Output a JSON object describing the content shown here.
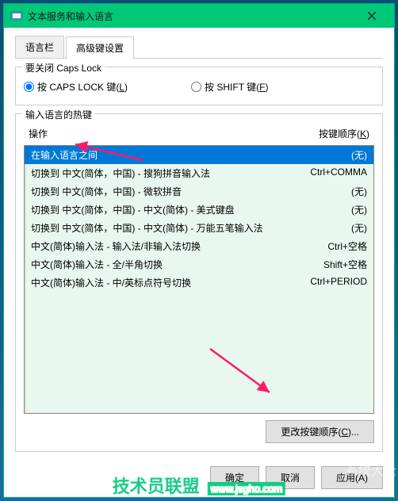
{
  "window": {
    "title": "文本服务和输入语言"
  },
  "tabs": {
    "tab1": "语言栏",
    "tab2": "高级键设置"
  },
  "capslock": {
    "legend": "要关闭 Caps Lock",
    "opt1_prefix": "按 CAPS LOCK 键(",
    "opt1_key": "L",
    "opt1_suffix": ")",
    "opt2_prefix": "按 SHIFT 键(",
    "opt2_key": "F",
    "opt2_suffix": ")"
  },
  "hotkeys": {
    "legend": "输入语言的热键",
    "col_action": "操作",
    "col_seq_prefix": "按键顺序(",
    "col_seq_key": "K",
    "col_seq_suffix": ")",
    "rows": [
      {
        "action": "在输入语言之间",
        "seq": "(无)"
      },
      {
        "action": "切换到 中文(简体，中国) - 搜狗拼音输入法",
        "seq": "Ctrl+COMMA"
      },
      {
        "action": "切换到 中文(简体，中国) - 微软拼音",
        "seq": "(无)"
      },
      {
        "action": "切换到 中文(简体，中国) - 中文(简体) - 美式键盘",
        "seq": "(无)"
      },
      {
        "action": "切换到 中文(简体，中国) - 中文(简体) - 万能五笔输入法",
        "seq": "(无)"
      },
      {
        "action": "中文(简体)输入法 - 输入法/非输入法切换",
        "seq": "Ctrl+空格"
      },
      {
        "action": "中文(简体)输入法 - 全/半角切换",
        "seq": "Shift+空格"
      },
      {
        "action": "中文(简体)输入法 - 中/英标点符号切换",
        "seq": "Ctrl+PERIOD"
      }
    ],
    "change_btn_prefix": "更改按键顺序(",
    "change_btn_key": "C",
    "change_btn_suffix": ")..."
  },
  "buttons": {
    "ok": "确定",
    "cancel": "取消",
    "apply": "应用(A)"
  },
  "watermark": {
    "text": "技术员联盟",
    "url": "www.jsgho.com"
  },
  "sidetext": "系统大全"
}
